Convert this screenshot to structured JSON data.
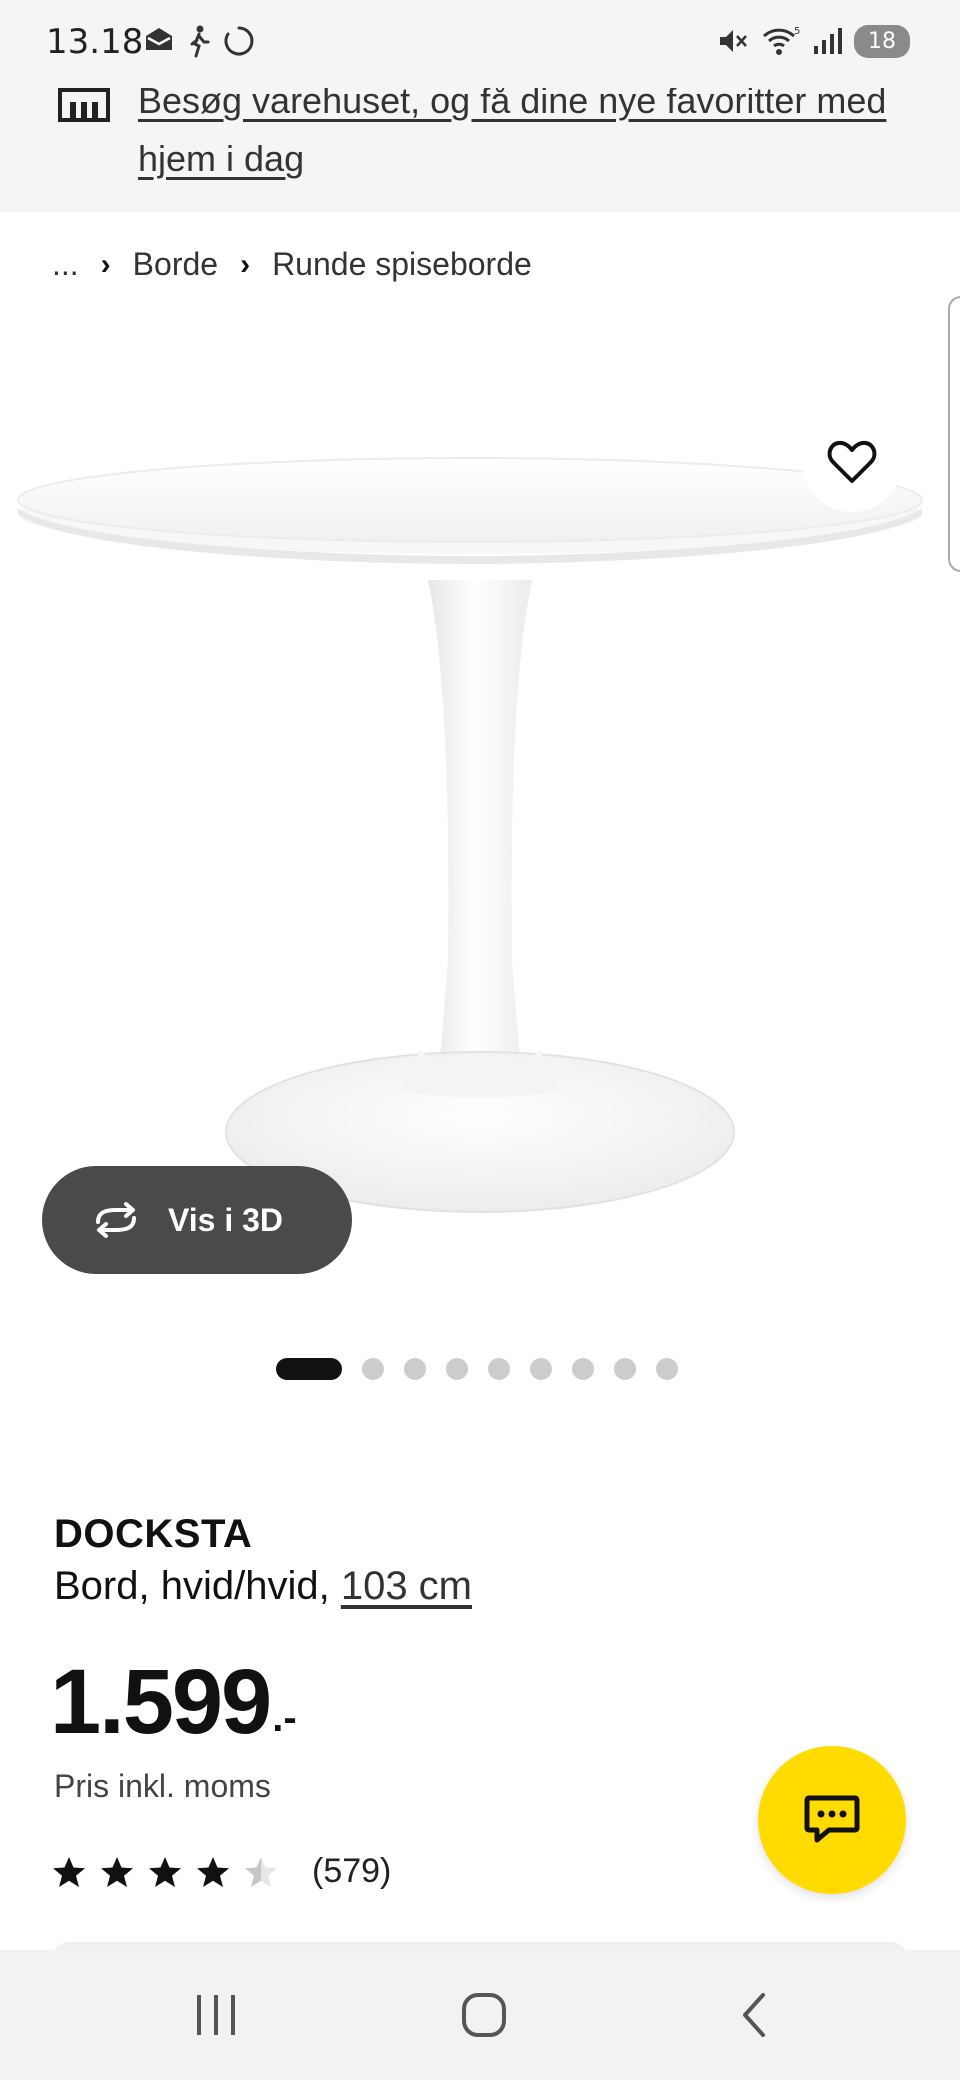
{
  "status_bar": {
    "time": "13.18",
    "battery": "18",
    "left_icons": [
      "message-icon",
      "walking-icon",
      "sync-icon"
    ],
    "right_icons": [
      "mute-icon",
      "wifi-icon",
      "signal-icon"
    ]
  },
  "banner": {
    "text": "Besøg varehuset, og få dine nye favoritter med hjem i dag",
    "icon": "store-icon"
  },
  "breadcrumb": {
    "items": [
      "...",
      "Borde",
      "Runde spiseborde"
    ]
  },
  "product": {
    "brand": "DOCKSTA",
    "description": "Bord, hvid/hvid, ",
    "size": "103 cm",
    "price": "1.599",
    "price_suffix": ".-",
    "vat_note": "Pris inkl. moms",
    "rating": 4.5,
    "rating_max": 5,
    "review_count": "(579)"
  },
  "image_gallery": {
    "view_3d_label": "Vis i 3D",
    "slide_count": 9,
    "active_slide": 1
  },
  "colors": {
    "accent_yellow": "#ffdb00",
    "dark_button": "#4a4a4a",
    "background_gray": "#f5f5f5"
  }
}
